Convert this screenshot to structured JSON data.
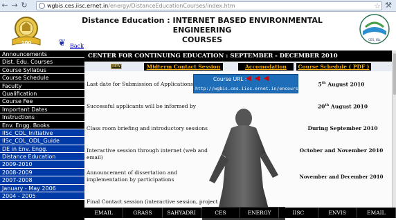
{
  "browser": {
    "url_host": "wgbis.ces.iisc.ernet.in",
    "url_path": "/energy/DistanceEducationCourses/index.htm"
  },
  "header": {
    "title_line1": "Distance Education : INTERNET BASED ENVIRONMENTAL ENGINEERING",
    "title_line2": "COURSES",
    "back_label": "Back",
    "logo_left_text": "100",
    "logo_right_text": "CES, IISc"
  },
  "sidebar": {
    "items": [
      {
        "label": "Announcements",
        "style": "black"
      },
      {
        "label": "Dist. Edu. Courses",
        "style": "black"
      },
      {
        "label": "Course Syllabus",
        "style": "black"
      },
      {
        "label": "Course Schedule",
        "style": "black"
      },
      {
        "label": "Faculty",
        "style": "black"
      },
      {
        "label": "Qualification",
        "style": "black"
      },
      {
        "label": "Course Fee",
        "style": "black"
      },
      {
        "label": "Important Dates",
        "style": "black"
      },
      {
        "label": "Instructions",
        "style": "black"
      },
      {
        "label": "Env. Engg. Books",
        "style": "black"
      },
      {
        "label": "IISc_COL_Initiative",
        "style": "blue"
      },
      {
        "label": "IISc_COL_ODL_Guide",
        "style": "blue"
      },
      {
        "label": "DE in Env. Engg.",
        "style": "blue"
      },
      {
        "label": "Distance Education",
        "style": "blue"
      },
      {
        "label": "2009-2010",
        "style": "blue"
      },
      {
        "label": "2008-2009",
        "style": "blue"
      },
      {
        "label": "2007-2008",
        "style": "blue"
      },
      {
        "label": "January - May 2006",
        "style": "blue"
      },
      {
        "label": "2004 - 2005",
        "style": "blue"
      }
    ]
  },
  "main": {
    "header": "CENTER FOR CONTINUING EDUCATION : SEPTEMBER - DECEMBER 2010",
    "tabs": {
      "new_badge": "NEW",
      "midterm": "Midterm Contact Session",
      "accomodation": "Accomodation",
      "schedule": "Course Schedule ( PDF )"
    },
    "course_url": {
      "label": "Course URL :",
      "arrows": "◀ ◀ ◀",
      "link": "http://wgbis.ces.iisc.ernet.in/encourse"
    },
    "rows": [
      {
        "label": "Last date for Submission of Applications",
        "value_pre": "5",
        "value_sup": "th",
        "value_post": " August 2010"
      },
      {
        "label": "Successful applicants will be informed by",
        "value_pre": "20",
        "value_sup": "th",
        "value_post": " August 2010"
      },
      {
        "label": "Class room briefing and introductory sessions",
        "value_pre": "During September 2010",
        "value_sup": "",
        "value_post": ""
      },
      {
        "label": "Interactive session through internet (web and email)",
        "value_pre": "October and November 2010",
        "value_sup": "",
        "value_post": ""
      },
      {
        "label": "Announcement of dissertation and implementation by participations",
        "value_pre": "November and December 2010",
        "value_sup": "",
        "value_post": ""
      },
      {
        "label": "Final Contact session (interactive session, project",
        "value_pre": "",
        "value_sup": "",
        "value_post": ""
      }
    ]
  },
  "footer": {
    "items": [
      "EMAIL",
      "GRASS",
      "SAHYADRI",
      "CES",
      "ENERGY",
      "IISC",
      "ENVIS",
      "EMAIL"
    ]
  },
  "colors": {
    "sidebar_black": "#000000",
    "sidebar_blue": "#003aa6",
    "tab_link": "#ffb000",
    "course_url_bg": "#1d6db9"
  }
}
